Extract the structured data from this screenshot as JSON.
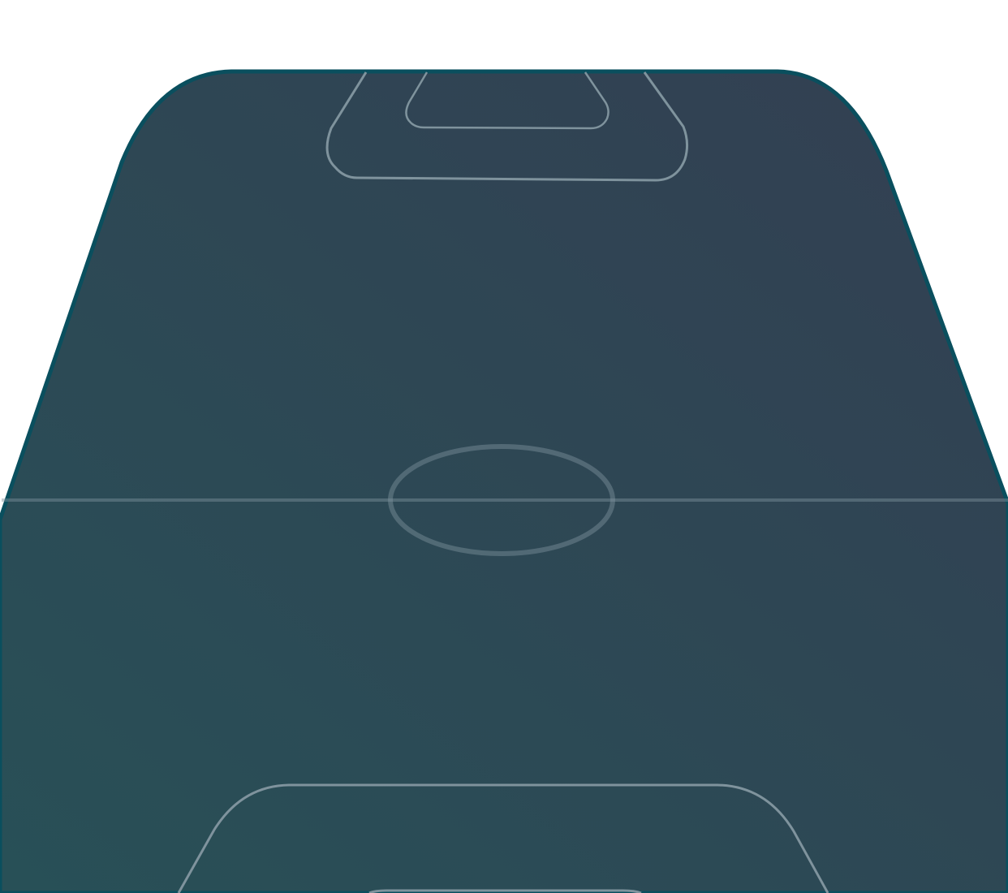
{
  "pitch": {
    "kind": "football-pitch",
    "view": "perspective",
    "colors": {
      "page_background": "#ffffff",
      "border": "#0a4f5e",
      "surface_top_right": "#333f52",
      "surface_bottom_left": "#285057",
      "line_markings": "#7f939d"
    },
    "markings": [
      "halfway-line",
      "center-circle",
      "top-penalty-area",
      "top-goal-area",
      "bottom-penalty-area",
      "bottom-goal-area"
    ]
  }
}
